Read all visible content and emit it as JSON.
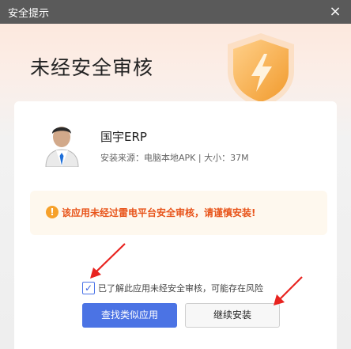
{
  "window": {
    "title": "安全提示",
    "close_glyph": "×"
  },
  "header": {
    "headline": "未经安全审核",
    "shield_icon": "lightning-shield-icon",
    "accent": "#f3a235"
  },
  "app": {
    "name": "国宇ERP",
    "meta": "安装来源：电脑本地APK | 大小：37M",
    "avatar_icon": "business-man-avatar"
  },
  "warning": {
    "icon": "exclamation-circle-icon",
    "text": "该应用未经过雷电平台安全审核，请谨慎安装!",
    "color": "#e8541a"
  },
  "acknowledge": {
    "checked": true,
    "label": "已了解此应用未经安全审核，可能存在风险"
  },
  "buttons": {
    "find_similar": "查找类似应用",
    "continue_install": "继续安装",
    "primary_color": "#4b73e4"
  },
  "annotations": {
    "arrow_color": "#e8231f"
  }
}
